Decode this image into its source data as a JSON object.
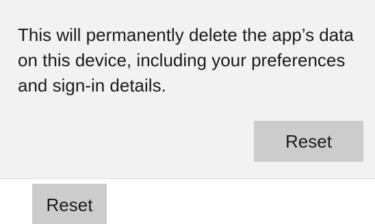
{
  "flyout": {
    "message": "This will permanently delete the app’s data on this device, including your preferences and sign-in details.",
    "confirm_label": "Reset"
  },
  "main": {
    "reset_label": "Reset"
  },
  "colors": {
    "flyout_background": "#f2f2f2",
    "button_background": "#cccccc",
    "text": "#1a1a1a"
  }
}
